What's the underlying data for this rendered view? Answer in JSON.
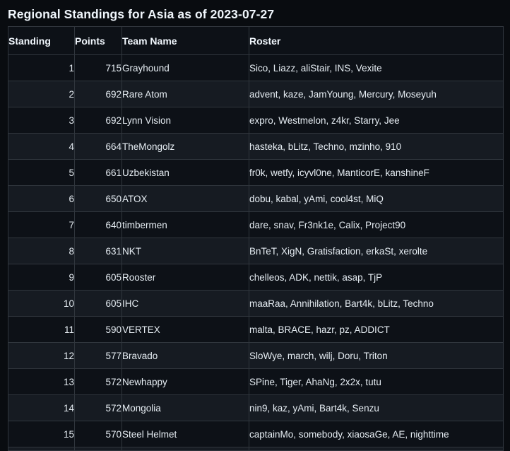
{
  "title": "Regional Standings for Asia as of 2023-07-27",
  "colors": {
    "page_background": "#090c10",
    "row_odd_background": "#0d1117",
    "row_even_background": "#161b22",
    "border": "#30363d",
    "text": "#e6edf3",
    "title_text": "#f0f6fc"
  },
  "table": {
    "columns": [
      "Standing",
      "Points",
      "Team Name",
      "Roster"
    ],
    "rows": [
      {
        "standing": "1",
        "points": "715",
        "team": "Grayhound",
        "roster": "Sico, Liazz, aliStair, INS, Vexite"
      },
      {
        "standing": "2",
        "points": "692",
        "team": "Rare Atom",
        "roster": "advent, kaze, JamYoung, Mercury, Moseyuh"
      },
      {
        "standing": "3",
        "points": "692",
        "team": "Lynn Vision",
        "roster": "expro, Westmelon, z4kr, Starry, Jee"
      },
      {
        "standing": "4",
        "points": "664",
        "team": "TheMongolz",
        "roster": "hasteka, bLitz, Techno, mzinho, 910"
      },
      {
        "standing": "5",
        "points": "661",
        "team": "Uzbekistan",
        "roster": "fr0k, wetfy, icyvl0ne, ManticorE, kanshineF"
      },
      {
        "standing": "6",
        "points": "650",
        "team": "ATOX",
        "roster": "dobu, kabal, yAmi, cool4st, MiQ"
      },
      {
        "standing": "7",
        "points": "640",
        "team": "timbermen",
        "roster": "dare, snav, Fr3nk1e, Calix, Project90"
      },
      {
        "standing": "8",
        "points": "631",
        "team": "NKT",
        "roster": "BnTeT, XigN, Gratisfaction, erkaSt, xerolte"
      },
      {
        "standing": "9",
        "points": "605",
        "team": "Rooster",
        "roster": "chelleos, ADK, nettik, asap, TjP"
      },
      {
        "standing": "10",
        "points": "605",
        "team": "IHC",
        "roster": "maaRaa, Annihilation, Bart4k, bLitz, Techno"
      },
      {
        "standing": "11",
        "points": "590",
        "team": "VERTEX",
        "roster": "malta, BRACE, hazr, pz, ADDICT"
      },
      {
        "standing": "12",
        "points": "577",
        "team": "Bravado",
        "roster": "SloWye, march, wilj, Doru, Triton"
      },
      {
        "standing": "13",
        "points": "572",
        "team": "Newhappy",
        "roster": "SPine, Tiger, AhaNg, 2x2x, tutu"
      },
      {
        "standing": "14",
        "points": "572",
        "team": "Mongolia",
        "roster": "nin9, kaz, yAmi, Bart4k, Senzu"
      },
      {
        "standing": "15",
        "points": "570",
        "team": "Steel Helmet",
        "roster": "captainMo, somebody, xiaosaGe, AE, nighttime"
      }
    ]
  }
}
